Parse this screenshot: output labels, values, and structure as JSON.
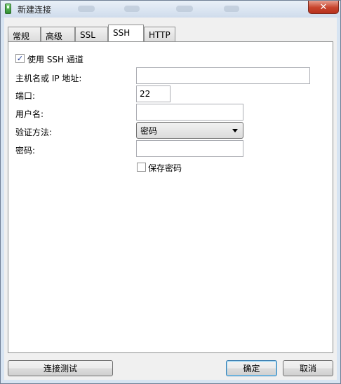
{
  "window": {
    "title": "新建连接",
    "close_glyph": "✕"
  },
  "tabs": [
    {
      "label": "常规"
    },
    {
      "label": "高级"
    },
    {
      "label": "SSL"
    },
    {
      "label": "SSH",
      "active": true
    },
    {
      "label": "HTTP"
    }
  ],
  "ssh": {
    "use_tunnel_label": "使用 SSH 通道",
    "use_tunnel_checked": true,
    "host_label": "主机名或 IP 地址:",
    "host_value": "",
    "port_label": "端口:",
    "port_value": "22",
    "username_label": "用户名:",
    "username_value": "",
    "auth_label": "验证方法:",
    "auth_value": "密码",
    "password_label": "密码:",
    "password_value": "",
    "save_password_label": "保存密码",
    "save_password_checked": false
  },
  "buttons": {
    "test_connection": "连接测试",
    "ok": "确定",
    "cancel": "取消"
  },
  "icons": {
    "check": "✓"
  }
}
